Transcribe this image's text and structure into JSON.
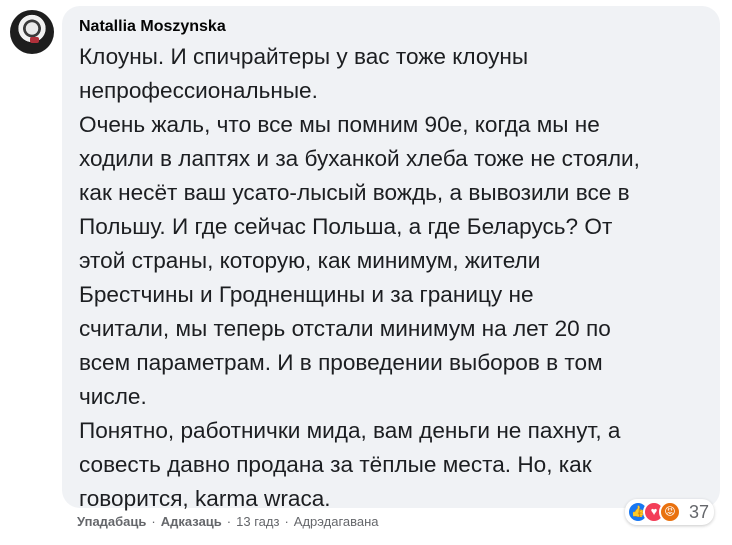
{
  "comment": {
    "author": "Natallia Moszynska",
    "lines": [
      "Клоуны. И спичрайтеры у вас тоже клоуны",
      "непрофессиональные.",
      "Очень жаль, что все мы помним 90е, когда мы не",
      "ходили в лаптях и за буханкой хлеба тоже не стояли,",
      "как несёт ваш усато-лысый вождь, а вывозили все в",
      "Польшу. И где сейчас Польша, а где Беларусь? От",
      "этой страны, которую, как минимум, жители",
      "Брестчины и Гродненщины и за границу не",
      "считали, мы теперь отстали минимум на лет 20 по",
      "всем параметрам. И в проведении выборов в том",
      "числе.",
      "Понятно, работнички мида, вам деньги не пахнут, а",
      "совесть давно продана за тёплые места. Но, как",
      "говорится, karma wraca."
    ],
    "reactions": {
      "count": "37",
      "icons": [
        "like-icon",
        "love-icon",
        "angry-icon"
      ]
    },
    "actions": {
      "like": "Упадабаць",
      "reply": "Адказаць",
      "time": "13 гадз",
      "edited": "Адрэдагавана"
    }
  },
  "colors": {
    "bubble": "#f0f2f5",
    "text": "#1c1e21",
    "meta": "#65676b",
    "like": "#1877f2",
    "love": "#f33e58",
    "angry": "#e9710f"
  }
}
